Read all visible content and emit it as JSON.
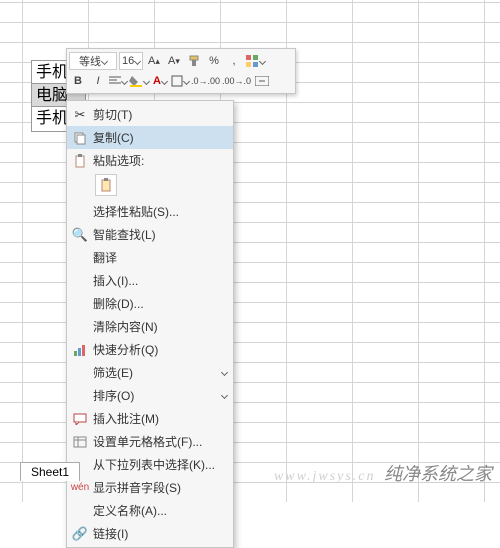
{
  "cells": {
    "a1": "手机",
    "a2": "电脑",
    "a3": "手机"
  },
  "mini": {
    "font": "等线",
    "size": "16",
    "row2": {
      "b": "B",
      "i": "I"
    }
  },
  "ctx": {
    "cut": "剪切(T)",
    "copy": "复制(C)",
    "paste_label": "粘贴选项:",
    "paste_special": "选择性粘贴(S)...",
    "smart_find": "智能查找(L)",
    "translate": "翻译",
    "insert": "插入(I)...",
    "delete": "删除(D)...",
    "clear": "清除内容(N)",
    "quick_analyze": "快速分析(Q)",
    "filter": "筛选(E)",
    "sort": "排序(O)",
    "comment": "插入批注(M)",
    "format_cells": "设置单元格格式(F)...",
    "from_dropdown": "从下拉列表中选择(K)...",
    "show_pinyin": "显示拼音字段(S)",
    "define_name": "定义名称(A)...",
    "hyperlink": "链接(I)"
  },
  "pct": "%",
  "comma": ",",
  "sheet": "Sheet1",
  "watermark": "纯净系统之家",
  "wm_url": "www.jwsys.cn"
}
